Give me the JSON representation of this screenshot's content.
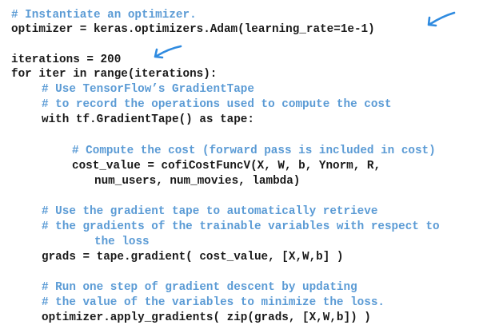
{
  "code": {
    "lines": [
      {
        "text": "# Instantiate an optimizer.",
        "kind": "comment"
      },
      {
        "text": "optimizer = keras.optimizers.Adam(learning_rate=1e-1)",
        "kind": "code"
      },
      {
        "text": "iterations = 200",
        "kind": "code"
      },
      {
        "text": "for iter in range(iterations):",
        "kind": "code"
      },
      {
        "text": "# Use TensorFlow’s GradientTape",
        "kind": "comment"
      },
      {
        "text": "# to record the operations used to compute the cost",
        "kind": "comment"
      },
      {
        "text": "with tf.GradientTape() as tape:",
        "kind": "code"
      },
      {
        "text": "# Compute the cost (forward pass is included in cost)",
        "kind": "comment"
      },
      {
        "text": "cost_value = cofiCostFuncV(X, W, b, Ynorm, R,",
        "kind": "code"
      },
      {
        "text": "num_users, num_movies, lambda)",
        "kind": "code"
      },
      {
        "text": "# Use the gradient tape to automatically retrieve",
        "kind": "comment"
      },
      {
        "text": "# the gradients of the trainable variables with respect to",
        "kind": "comment"
      },
      {
        "text": "the loss",
        "kind": "comment"
      },
      {
        "text": "grads = tape.gradient( cost_value, [X,W,b] )",
        "kind": "code"
      },
      {
        "text": "# Run one step of gradient descent by updating",
        "kind": "comment"
      },
      {
        "text": "# the value of the variables to minimize the loss.",
        "kind": "comment"
      },
      {
        "text": "optimizer.apply_gradients( zip(grads, [X,W,b]) )",
        "kind": "code"
      }
    ]
  },
  "annotations": {
    "arrow_color": "#2f8be0",
    "arrows": [
      {
        "icon": "hand-drawn-arrow-icon"
      },
      {
        "icon": "hand-drawn-arrow-icon"
      }
    ]
  }
}
